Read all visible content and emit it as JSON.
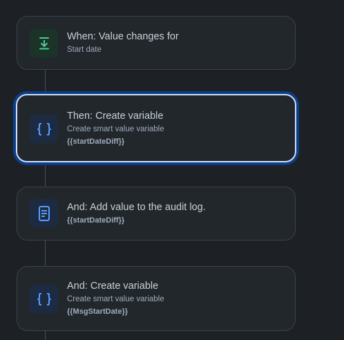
{
  "colors": {
    "background": "#1d2125",
    "card": "#22272b",
    "selected_border": "#cfe1fd",
    "selected_glow": "#0c3d86",
    "trigger_icon": "#4bce97",
    "action_icon": "#579dff"
  },
  "rules": [
    {
      "icon": "download-icon",
      "title": "When: Value changes for",
      "subtitle": "Start date",
      "selected": false
    },
    {
      "icon": "curly-braces-icon",
      "title": "Then: Create variable",
      "subtitle": "Create smart value variable",
      "token": "{{startDateDiff}}",
      "selected": true
    },
    {
      "icon": "document-icon",
      "title": "And: Add value to the audit log.",
      "token": "{{startDateDiff}}",
      "selected": false
    },
    {
      "icon": "curly-braces-icon",
      "title": "And: Create variable",
      "subtitle": "Create smart value variable",
      "token": "{{MsgStartDate}}",
      "selected": false
    }
  ]
}
